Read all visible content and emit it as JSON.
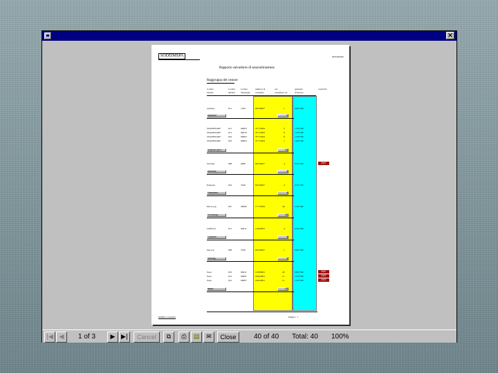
{
  "window": {
    "close_glyph": "×"
  },
  "report": {
    "company": "SODEIMSPA",
    "date": "qpnloppslpp",
    "title": "Rapporto salvadores di sanzonitrasmess",
    "section": "Raggruppa del cestore",
    "headers": {
      "h1a": "Codice",
      "h1b": "Utente",
      "h2a": "Codice",
      "h2b": "attività",
      "h3a": "Codice",
      "h3b": "Tipologia",
      "h4a": "numero di",
      "h4b": "consumo",
      "h5a": "ore",
      "h5b": "consultaz ore",
      "h6a": "giornata",
      "h6b": "di lavoro",
      "h7": "controllo"
    },
    "rows": [
      {
        "name": "sanchez",
        "c2": "011",
        "c3": "1100",
        "num": "6613000+",
        "ore": "1",
        "date": "06/07/96",
        "flag": ""
      },
      {
        "name": "SNANETAEF",
        "c2": "011",
        "c3": "00003",
        "num": "37+13001",
        "ore": "5",
        "date": "17/07/96",
        "flag": ""
      },
      {
        "name": "SNANETAEF",
        "c2": "011",
        "c3": "00010",
        "num": "37+13001",
        "ore": "8",
        "date": "17/07/96",
        "flag": ""
      },
      {
        "name": "SNANETAEF",
        "c2": "010",
        "c3": "00003",
        "num": "37+13001",
        "ore": "8",
        "date": "17/07/96",
        "flag": ""
      },
      {
        "name": "SNANETAEF",
        "c2": "010",
        "c3": "00003",
        "num": "37+13001",
        "ore": "1",
        "date": "19/07/96",
        "flag": ""
      },
      {
        "name": "bravahe",
        "c2": "008",
        "c3": "0000",
        "num": "6613000+",
        "ore": "4",
        "date": "07/07/96",
        "flag": "ZWT"
      },
      {
        "name": "Passarea",
        "c2": "010",
        "c3": "3100",
        "num": "6613000+",
        "ore": "4",
        "date": "07/07/96",
        "flag": ""
      },
      {
        "name": "Pill scoop",
        "c2": "00+",
        "c3": "00006",
        "num": "7+1+0001",
        "ore": "30",
        "date": "11/07/96",
        "flag": ""
      },
      {
        "name": "Chiffoiel",
        "c2": "011",
        "c3": "00011",
        "num": "14100001",
        "ore": "4",
        "date": "07/07/96",
        "flag": ""
      },
      {
        "name": "hnoovg",
        "c2": "009",
        "c3": "3700",
        "num": "6613000+",
        "ore": "1",
        "date": "06/07/96",
        "flag": ""
      },
      {
        "name": "fasso",
        "c2": "010",
        "c3": "00011",
        "num": "14780001",
        "ore": "20",
        "date": "08/07/96",
        "flag": "ZWT"
      },
      {
        "name": "fasso",
        "c2": "012",
        "c3": "00007",
        "num": "22222001",
        "ore": "11",
        "date": "17/07/96",
        "flag": "ZWT"
      },
      {
        "name": "fasso",
        "c2": "012",
        "c3": "00007",
        "num": "22222001",
        "ore": "11",
        "date": "17/07/96",
        "flag": "ZWT"
      }
    ],
    "subtotals": [
      {
        "label": "sanchez",
        "sum": "1"
      },
      {
        "label": "SNANETAEF",
        "sum": "34"
      },
      {
        "label": "bravahe",
        "sum": "4"
      },
      {
        "label": "Passarea",
        "sum": "4"
      },
      {
        "label": "Pill scoop",
        "sum": "30"
      },
      {
        "label": "Chiffoiel",
        "sum": "4"
      },
      {
        "label": "hnoovg",
        "sum": "1"
      },
      {
        "label": "fasso",
        "sum": "42"
      }
    ],
    "footer_left": "Mambi Contrstria",
    "footer_right": "Pagina :  1"
  },
  "statusbar": {
    "first": "|◀",
    "prev": "◀",
    "page": "1 of 3",
    "next": "▶",
    "last": "▶|",
    "cancel": "Cancel",
    "zoom_icon": "⧉",
    "print_icon": "⎙",
    "export_icon": "▤",
    "mail_icon": "✉",
    "close": "Close",
    "records": "40 of 40",
    "total": "Total: 40",
    "zoom": "100%"
  },
  "colors": {
    "yellow_column": "#ffff00",
    "cyan_column": "#00ffff",
    "flag": "#a01010",
    "titlebar": "#000080"
  }
}
